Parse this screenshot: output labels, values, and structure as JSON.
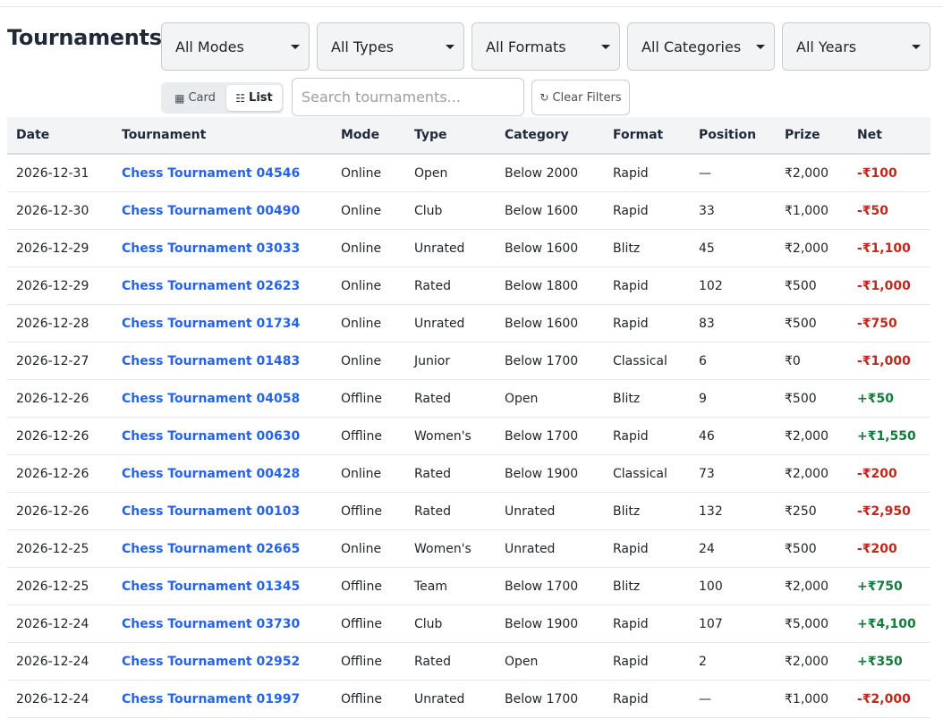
{
  "page": {
    "title": "Tournaments"
  },
  "filters": {
    "mode": "All Modes",
    "type": "All Types",
    "format": "All Formats",
    "category": "All Categories",
    "year": "All Years"
  },
  "view_toggle": {
    "card_label": "Card",
    "list_label": "List",
    "active": "list"
  },
  "search": {
    "placeholder": "Search tournaments...",
    "value": ""
  },
  "clear_filters_label": "Clear Filters",
  "icons": {
    "card": "grid-icon",
    "list": "list-icon",
    "clear": "refresh-icon",
    "dropdown": "chevron-down-icon"
  },
  "colors": {
    "link": "#2563eb",
    "negative": "#c0281c",
    "positive": "#157a3a"
  },
  "table": {
    "headers": [
      "Date",
      "Tournament",
      "Mode",
      "Type",
      "Category",
      "Format",
      "Position",
      "Prize",
      "Net"
    ],
    "rows": [
      [
        "2026-12-31",
        "Chess Tournament 04546",
        "Online",
        "Open",
        "Below 2000",
        "Rapid",
        "—",
        "₹2,000",
        "-₹100"
      ],
      [
        "2026-12-30",
        "Chess Tournament 00490",
        "Online",
        "Club",
        "Below 1600",
        "Rapid",
        "33",
        "₹1,000",
        "-₹50"
      ],
      [
        "2026-12-29",
        "Chess Tournament 03033",
        "Online",
        "Unrated",
        "Below 1600",
        "Blitz",
        "45",
        "₹2,000",
        "-₹1,100"
      ],
      [
        "2026-12-29",
        "Chess Tournament 02623",
        "Online",
        "Rated",
        "Below 1800",
        "Rapid",
        "102",
        "₹500",
        "-₹1,000"
      ],
      [
        "2026-12-28",
        "Chess Tournament 01734",
        "Online",
        "Unrated",
        "Below 1600",
        "Rapid",
        "83",
        "₹500",
        "-₹750"
      ],
      [
        "2026-12-27",
        "Chess Tournament 01483",
        "Online",
        "Junior",
        "Below 1700",
        "Classical",
        "6",
        "₹0",
        "-₹1,000"
      ],
      [
        "2026-12-26",
        "Chess Tournament 04058",
        "Offline",
        "Rated",
        "Open",
        "Blitz",
        "9",
        "₹500",
        "+₹50"
      ],
      [
        "2026-12-26",
        "Chess Tournament 00630",
        "Offline",
        "Women's",
        "Below 1700",
        "Rapid",
        "46",
        "₹2,000",
        "+₹1,550"
      ],
      [
        "2026-12-26",
        "Chess Tournament 00428",
        "Online",
        "Rated",
        "Below 1900",
        "Classical",
        "73",
        "₹2,000",
        "-₹200"
      ],
      [
        "2026-12-26",
        "Chess Tournament 00103",
        "Offline",
        "Rated",
        "Unrated",
        "Blitz",
        "132",
        "₹250",
        "-₹2,950"
      ],
      [
        "2026-12-25",
        "Chess Tournament 02665",
        "Online",
        "Women's",
        "Unrated",
        "Rapid",
        "24",
        "₹500",
        "-₹200"
      ],
      [
        "2026-12-25",
        "Chess Tournament 01345",
        "Offline",
        "Team",
        "Below 1700",
        "Blitz",
        "100",
        "₹2,000",
        "+₹750"
      ],
      [
        "2026-12-24",
        "Chess Tournament 03730",
        "Offline",
        "Club",
        "Below 1900",
        "Rapid",
        "107",
        "₹5,000",
        "+₹4,100"
      ],
      [
        "2026-12-24",
        "Chess Tournament 02952",
        "Offline",
        "Rated",
        "Open",
        "Rapid",
        "2",
        "₹2,000",
        "+₹350"
      ],
      [
        "2026-12-24",
        "Chess Tournament 01997",
        "Offline",
        "Unrated",
        "Below 1700",
        "Rapid",
        "—",
        "₹1,000",
        "-₹2,000"
      ]
    ]
  }
}
